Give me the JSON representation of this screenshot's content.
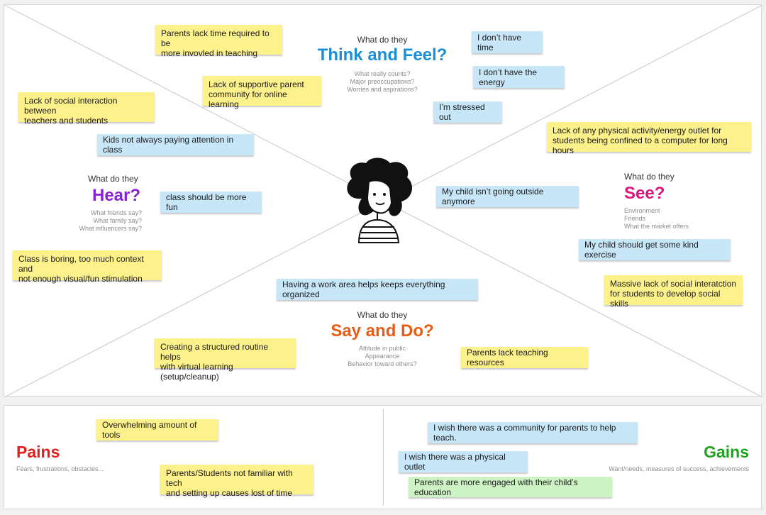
{
  "colors": {
    "think_feel": "#1b8fd6",
    "hear": "#8a23d6",
    "see": "#e0147a",
    "say_do": "#ec5b14",
    "pains": "#e41d1d",
    "gains": "#1fa31f",
    "sticky_yellow": "#fdf18c",
    "sticky_blue": "#c7e6f8",
    "sticky_green": "#cdf2c3"
  },
  "avatar": {
    "icon": "person-avatar-icon"
  },
  "quadrants": {
    "think_feel": {
      "prompt": "What do they",
      "title": "Think and Feel?",
      "subs": [
        "What really counts?",
        "Major preoccupations?",
        "Worries and aspirations?"
      ]
    },
    "hear": {
      "prompt": "What do they",
      "title": "Hear?",
      "subs": [
        "What friends say?",
        "What family say?",
        "What influencers say?"
      ]
    },
    "see": {
      "prompt": "What do they",
      "title": "See?",
      "subs": [
        "Environment",
        "Friends",
        "What the market offers"
      ]
    },
    "say_do": {
      "prompt": "What do they",
      "title": "Say and Do?",
      "subs": [
        "Attitude in public",
        "Appearance",
        "Behavior toward others?"
      ]
    }
  },
  "notes": {
    "think_feel": [
      "Parents lack time required to be\nmore invovled in teaching",
      "Lack of supportive parent\ncommunity for online learning",
      "I don’t have time",
      "I don’t have the energy",
      "I’m stressed out"
    ],
    "hear": [
      "Lack of social interaction between\nteachers and students",
      "Kids not always paying attention in class",
      "class should be more fun",
      "Class is boring, too much context and\nnot enough visual/fun stimulation"
    ],
    "see": [
      "Lack of any physical activity/energy outlet for\nstudents being  confined to a computer for long hours",
      "My child isn’t going outside anymore",
      "My child should get some kind exercise",
      "Massive lack of social interatction\nfor students to develop social skills"
    ],
    "say_do": [
      "Having a work area helps keeps everything organized",
      "Creating a structured routine helps\nwith virtual learning (setup/cleanup)",
      "Parents lack teaching resources"
    ]
  },
  "pains": {
    "title": "Pains",
    "sub": "Fears, frustrations, obstacles...",
    "notes": [
      "Overwhelming amount of tools",
      "Parents/Students not familiar with tech\nand setting up causes lost of time"
    ]
  },
  "gains": {
    "title": "Gains",
    "sub": "Want/needs, measures of success, achievements",
    "notes": [
      "I wish there was a community for parents to help teach.",
      "I wish there was a physical outlet",
      "Parents are more engaged with their child’s education"
    ]
  }
}
